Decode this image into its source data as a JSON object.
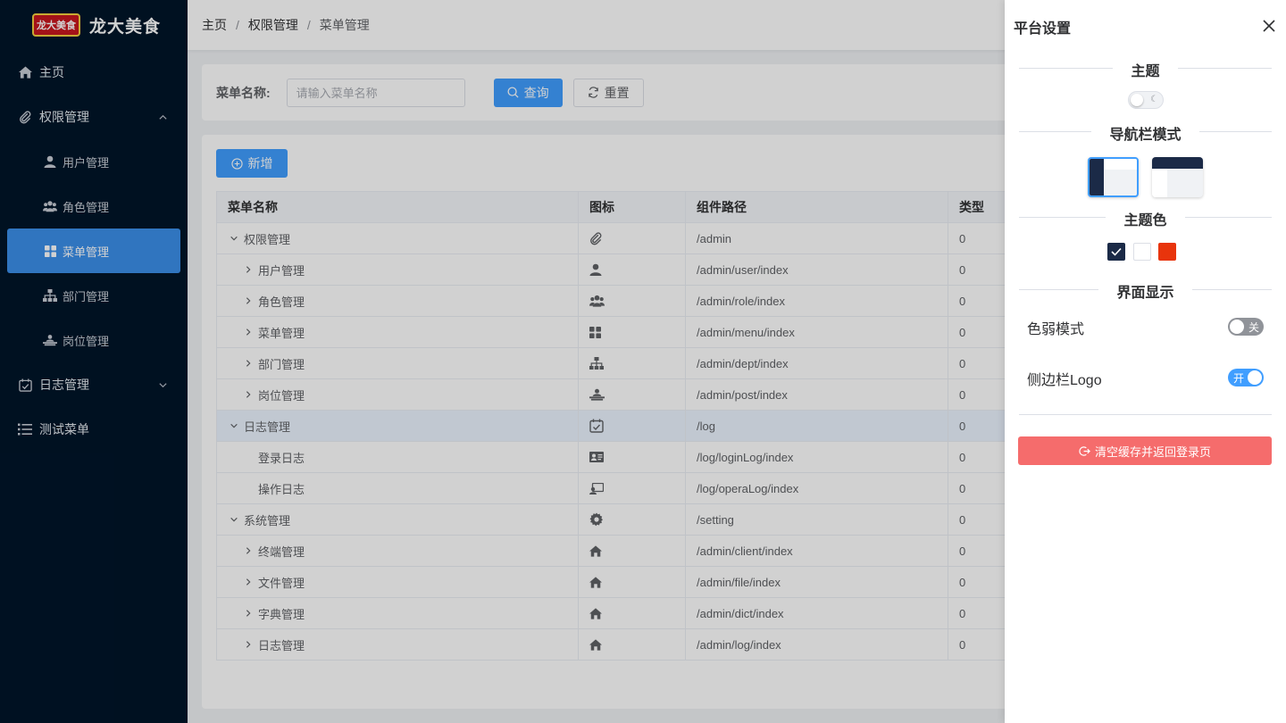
{
  "app": {
    "logo_text": "龙大美食",
    "logo_badge": "龙大美食"
  },
  "sidebar": {
    "items": [
      {
        "label": "主页",
        "icon": "home-icon"
      },
      {
        "label": "权限管理",
        "icon": "paperclip-icon",
        "expanded": true
      },
      {
        "label": "用户管理",
        "icon": "user-icon"
      },
      {
        "label": "角色管理",
        "icon": "users-icon"
      },
      {
        "label": "菜单管理",
        "icon": "grid-icon",
        "active": true
      },
      {
        "label": "部门管理",
        "icon": "sitemap-icon"
      },
      {
        "label": "岗位管理",
        "icon": "post-icon"
      },
      {
        "label": "日志管理",
        "icon": "calendar-check-icon",
        "expanded": false
      },
      {
        "label": "测试菜单",
        "icon": "list-icon"
      }
    ]
  },
  "breadcrumb": [
    "主页",
    "权限管理",
    "菜单管理"
  ],
  "search": {
    "label": "菜单名称:",
    "placeholder": "请输入菜单名称",
    "query_label": "查询",
    "reset_label": "重置"
  },
  "toolbar": {
    "add_label": "新增"
  },
  "table": {
    "columns": [
      "菜单名称",
      "图标",
      "组件路径",
      "类型"
    ],
    "rows": [
      {
        "name": "权限管理",
        "level": 0,
        "expander": "down",
        "icon": "paperclip-icon",
        "path": "/admin",
        "type": "0"
      },
      {
        "name": "用户管理",
        "level": 1,
        "expander": "right",
        "icon": "user-icon",
        "path": "/admin/user/index",
        "type": "0"
      },
      {
        "name": "角色管理",
        "level": 1,
        "expander": "right",
        "icon": "users-icon",
        "path": "/admin/role/index",
        "type": "0"
      },
      {
        "name": "菜单管理",
        "level": 1,
        "expander": "right",
        "icon": "grid-icon",
        "path": "/admin/menu/index",
        "type": "0"
      },
      {
        "name": "部门管理",
        "level": 1,
        "expander": "right",
        "icon": "sitemap-icon",
        "path": "/admin/dept/index",
        "type": "0"
      },
      {
        "name": "岗位管理",
        "level": 1,
        "expander": "right",
        "icon": "post-icon",
        "path": "/admin/post/index",
        "type": "0"
      },
      {
        "name": "日志管理",
        "level": 0,
        "expander": "down",
        "icon": "calendar-check-icon",
        "path": "/log",
        "type": "0",
        "highlight": true
      },
      {
        "name": "登录日志",
        "level": 1,
        "expander": "none",
        "icon": "id-card-icon",
        "path": "/log/loginLog/index",
        "type": "0"
      },
      {
        "name": "操作日志",
        "level": 1,
        "expander": "none",
        "icon": "screen-user-icon",
        "path": "/log/operaLog/index",
        "type": "0"
      },
      {
        "name": "系统管理",
        "level": 0,
        "expander": "down",
        "icon": "gear-icon",
        "path": "/setting",
        "type": "0"
      },
      {
        "name": "终端管理",
        "level": 1,
        "expander": "right",
        "icon": "home-icon",
        "path": "/admin/client/index",
        "type": "0"
      },
      {
        "name": "文件管理",
        "level": 1,
        "expander": "right",
        "icon": "home-icon",
        "path": "/admin/file/index",
        "type": "0"
      },
      {
        "name": "字典管理",
        "level": 1,
        "expander": "right",
        "icon": "home-icon",
        "path": "/admin/dict/index",
        "type": "0"
      },
      {
        "name": "日志管理",
        "level": 1,
        "expander": "right",
        "icon": "home-icon",
        "path": "/admin/log/index",
        "type": "0"
      }
    ]
  },
  "drawer": {
    "title": "平台设置",
    "section_theme": "主题",
    "section_nav": "导航栏模式",
    "section_color": "主题色",
    "section_display": "界面显示",
    "colorblind_label": "色弱模式",
    "colorblind_state": "关",
    "sidebar_logo_label": "侧边栏Logo",
    "sidebar_logo_state": "开",
    "reset_label": "清空缓存并返回登录页",
    "colors": [
      "#1b2a47",
      "#ffffff",
      "#e8340c"
    ]
  }
}
